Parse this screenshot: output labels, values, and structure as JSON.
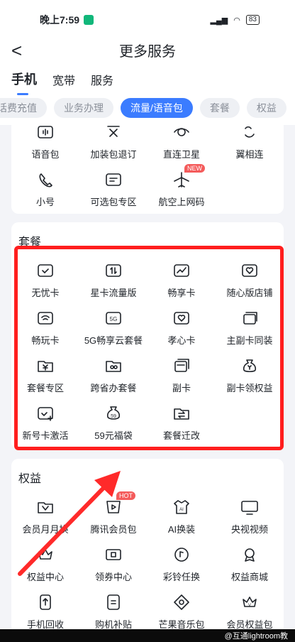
{
  "status": {
    "time": "晚上7:59",
    "battery": "83"
  },
  "nav": {
    "title": "更多服务",
    "back": "<"
  },
  "top_tabs": [
    {
      "label": "手机"
    },
    {
      "label": "宽带"
    },
    {
      "label": "服务"
    }
  ],
  "chips": [
    {
      "label": "话费充值"
    },
    {
      "label": "业务办理"
    },
    {
      "label": "流量/语音包"
    },
    {
      "label": "套餐"
    },
    {
      "label": "权益"
    }
  ],
  "voice_section": {
    "items": [
      {
        "label": "语音包",
        "icon": "voice-pack-icon"
      },
      {
        "label": "加装包退订",
        "icon": "unsubscribe-icon"
      },
      {
        "label": "直连卫星",
        "icon": "satellite-icon"
      },
      {
        "label": "翼相连",
        "icon": "link-icon"
      },
      {
        "label": "小号",
        "icon": "phone-call-icon"
      },
      {
        "label": "可选包专区",
        "icon": "optional-package-icon"
      },
      {
        "label": "航空上网码",
        "icon": "airplane-icon",
        "badge": "NEW"
      }
    ]
  },
  "plan_section": {
    "title": "套餐",
    "items": [
      {
        "label": "无忧卡",
        "icon": "check-card-icon"
      },
      {
        "label": "星卡流量版",
        "icon": "data-card-icon"
      },
      {
        "label": "畅享卡",
        "icon": "trend-card-icon"
      },
      {
        "label": "随心版店铺",
        "icon": "heart-shop-icon"
      },
      {
        "label": "畅玩卡",
        "icon": "wifi-card-icon"
      },
      {
        "label": "5G畅享云套餐",
        "icon": "5g-icon"
      },
      {
        "label": "孝心卡",
        "icon": "heart-card-icon"
      },
      {
        "label": "主副卡同装",
        "icon": "dual-card-icon"
      },
      {
        "label": "套餐专区",
        "icon": "yuan-folder-icon"
      },
      {
        "label": "跨省办套餐",
        "icon": "cross-province-icon"
      },
      {
        "label": "副卡",
        "icon": "sub-card-icon"
      },
      {
        "label": "副卡领权益",
        "icon": "money-bag-icon"
      },
      {
        "label": "新号卡激活",
        "icon": "activate-card-icon"
      },
      {
        "label": "59元福袋",
        "icon": "lucky-bag-icon"
      },
      {
        "label": "套餐迁改",
        "icon": "switch-folder-icon"
      }
    ]
  },
  "rights_section": {
    "title": "权益",
    "items": [
      {
        "label": "会员月月换",
        "icon": "member-icon"
      },
      {
        "label": "腾讯会员包",
        "icon": "video-play-icon",
        "badge": "HOT"
      },
      {
        "label": "AI换装",
        "icon": "shirt-ai-icon"
      },
      {
        "label": "央视视频",
        "icon": "cctv-icon"
      },
      {
        "label": "权益中心",
        "icon": "crown-icon"
      },
      {
        "label": "领券中心",
        "icon": "coupon-icon"
      },
      {
        "label": "彩铃任换",
        "icon": "ringtone-icon"
      },
      {
        "label": "权益商城",
        "icon": "medal-icon"
      },
      {
        "label": "手机回收",
        "icon": "recycle-icon"
      },
      {
        "label": "购机补贴",
        "icon": "subsidy-icon"
      },
      {
        "label": "芒果音乐包",
        "icon": "music-icon"
      },
      {
        "label": "会员权益包",
        "icon": "vip-icon"
      }
    ]
  },
  "footer": {
    "watermark": "@互通lightroom教"
  },
  "colors": {
    "accent": "#3b7cff",
    "highlight": "#ff1e1e",
    "arrow": "#ff2a2a",
    "badge": "#f45b5b"
  }
}
